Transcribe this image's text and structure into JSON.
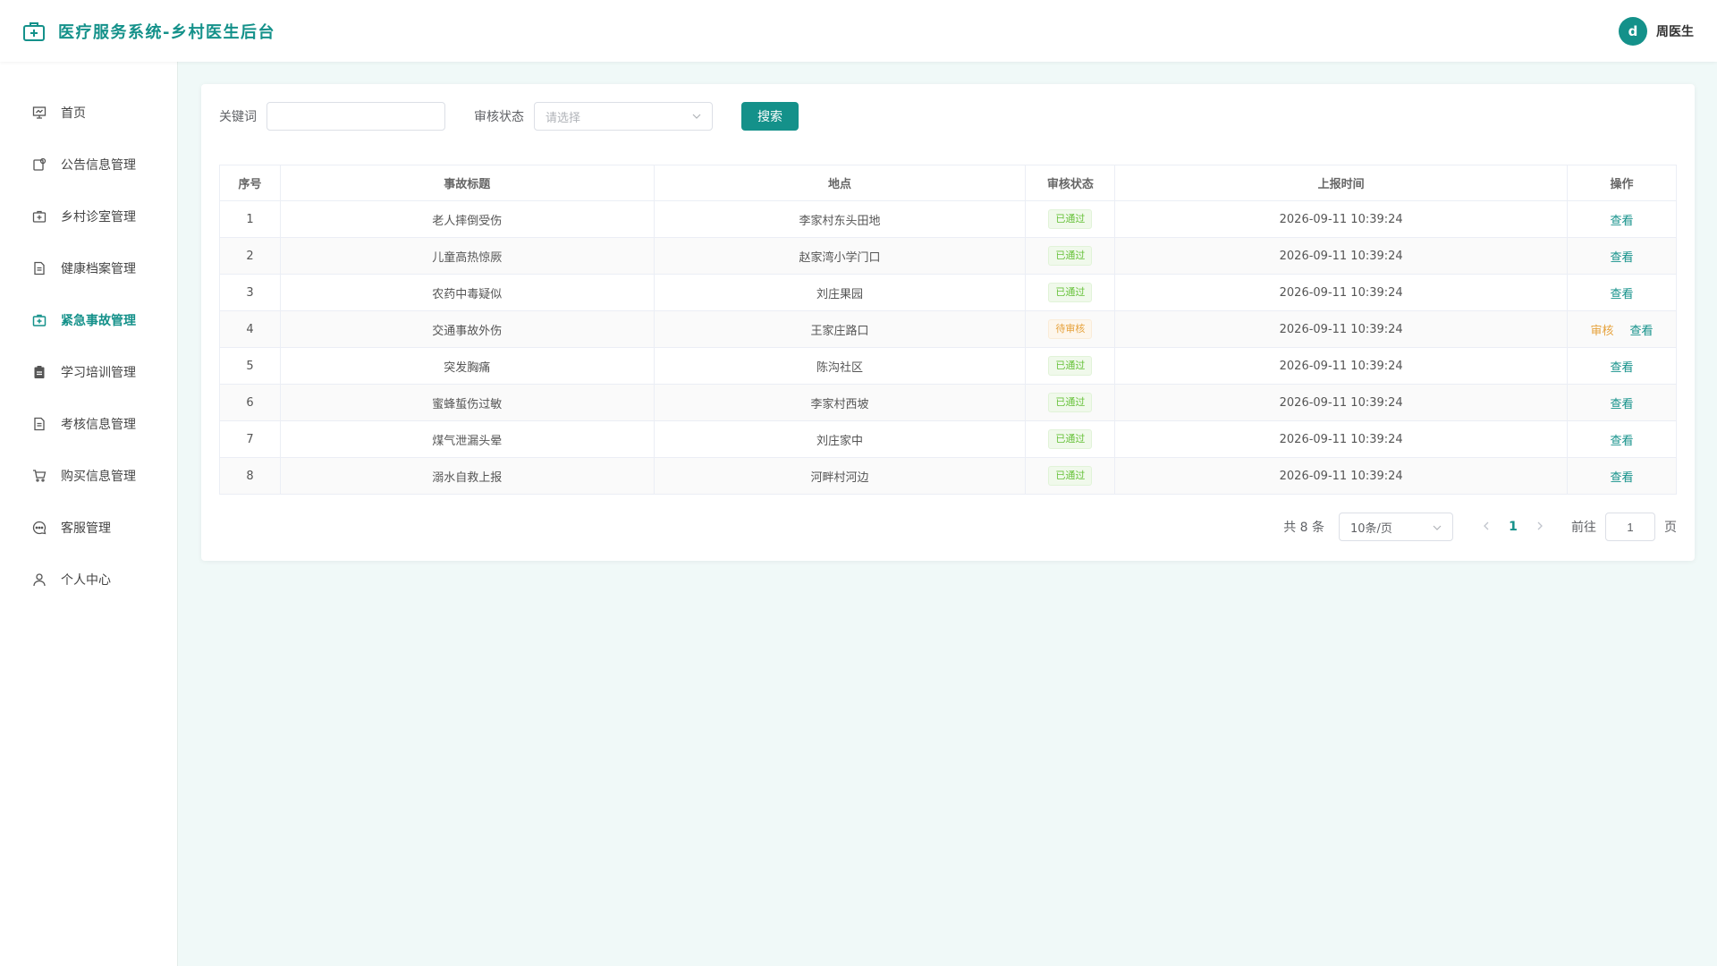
{
  "header": {
    "title": "医疗服务系统-乡村医生后台",
    "avatar_letter": "d",
    "user_name": "周医生"
  },
  "sidebar": {
    "items": [
      {
        "label": "首页",
        "icon": "presentation-icon"
      },
      {
        "label": "公告信息管理",
        "icon": "notice-icon"
      },
      {
        "label": "乡村诊室管理",
        "icon": "medical-kit-icon"
      },
      {
        "label": "健康档案管理",
        "icon": "document-icon"
      },
      {
        "label": "紧急事故管理",
        "icon": "medical-kit-icon",
        "active": true
      },
      {
        "label": "学习培训管理",
        "icon": "clipboard-icon"
      },
      {
        "label": "考核信息管理",
        "icon": "document-icon"
      },
      {
        "label": "购买信息管理",
        "icon": "cart-icon"
      },
      {
        "label": "客服管理",
        "icon": "chat-icon"
      },
      {
        "label": "个人中心",
        "icon": "user-icon"
      }
    ]
  },
  "filters": {
    "keyword_label": "关键词",
    "keyword_value": "",
    "status_label": "审核状态",
    "status_placeholder": "请选择",
    "search_button": "搜索"
  },
  "table": {
    "columns": [
      "序号",
      "事故标题",
      "地点",
      "审核状态",
      "上报时间",
      "操作"
    ],
    "rows": [
      {
        "no": "1",
        "title": "老人摔倒受伤",
        "location": "李家村东头田地",
        "status": "已通过",
        "time": "2026-09-11 10:39:24"
      },
      {
        "no": "2",
        "title": "儿童高热惊厥",
        "location": "赵家湾小学门口",
        "status": "已通过",
        "time": "2026-09-11 10:39:24"
      },
      {
        "no": "3",
        "title": "农药中毒疑似",
        "location": "刘庄果园",
        "status": "已通过",
        "time": "2026-09-11 10:39:24"
      },
      {
        "no": "4",
        "title": "交通事故外伤",
        "location": "王家庄路口",
        "status": "待审核",
        "time": "2026-09-11 10:39:24"
      },
      {
        "no": "5",
        "title": "突发胸痛",
        "location": "陈沟社区",
        "status": "已通过",
        "time": "2026-09-11 10:39:24"
      },
      {
        "no": "6",
        "title": "蜜蜂蜇伤过敏",
        "location": "李家村西坡",
        "status": "已通过",
        "time": "2026-09-11 10:39:24"
      },
      {
        "no": "7",
        "title": "煤气泄漏头晕",
        "location": "刘庄家中",
        "status": "已通过",
        "time": "2026-09-11 10:39:24"
      },
      {
        "no": "8",
        "title": "溺水自救上报",
        "location": "河畔村河边",
        "status": "已通过",
        "time": "2026-09-11 10:39:24"
      }
    ],
    "view_label": "查看",
    "audit_label": "审核",
    "pending_status": "待审核"
  },
  "pagination": {
    "total": "共 8 条",
    "page_size": "10条/页",
    "current_page": "1",
    "goto_label": "前往",
    "goto_value": "1",
    "page_unit": "页"
  },
  "colors": {
    "primary": "#14918a",
    "approved": "#67c23a",
    "pending": "#e6a23c"
  }
}
